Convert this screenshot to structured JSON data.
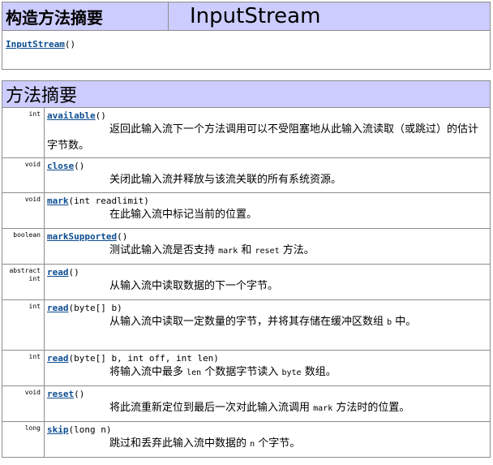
{
  "constructor_summary": {
    "heading": "构造方法摘要",
    "class_name": "InputStream",
    "constructor": {
      "name": "InputStream",
      "params": "()"
    }
  },
  "method_summary": {
    "heading": "方法摘要",
    "methods": [
      {
        "type": "int",
        "name": "available",
        "params": "()",
        "desc": "返回此输入流下一个方法调用可以不受阻塞地从此输入流读取（或跳过）的估计字节数。"
      },
      {
        "type": "void",
        "name": "close",
        "params": "()",
        "desc": "关闭此输入流并释放与该流关联的所有系统资源。"
      },
      {
        "type": "void",
        "name": "mark",
        "params": "(int readlimit)",
        "desc": "在此输入流中标记当前的位置。"
      },
      {
        "type": "boolean",
        "name": "markSupported",
        "params": "()",
        "desc_pre": "测试此输入流是否支持 ",
        "desc_code1": "mark",
        "desc_mid": " 和 ",
        "desc_code2": "reset",
        "desc_post": " 方法。"
      },
      {
        "type": "abstract int",
        "type_line1": "abstract",
        "type_line2": "int",
        "name": "read",
        "params": "()",
        "desc": "从输入流中读取数据的下一个字节。"
      },
      {
        "type": "int",
        "name": "read",
        "params": "(byte[] b)",
        "desc_pre": "从输入流中读取一定数量的字节，并将其存储在缓冲区数组 ",
        "desc_code1": "b",
        "desc_post": " 中。"
      },
      {
        "type": "int",
        "name": "read",
        "params": "(byte[] b, int off, int len)",
        "desc_pre": "将输入流中最多 ",
        "desc_code1": "len",
        "desc_mid": " 个数据字节读入 ",
        "desc_code2": "byte",
        "desc_post": " 数组。"
      },
      {
        "type": "void",
        "name": "reset",
        "params": "()",
        "desc_pre": "将此流重新定位到最后一次对此输入流调用 ",
        "desc_code1": "mark",
        "desc_post": " 方法时的位置。"
      },
      {
        "type": "long",
        "name": "skip",
        "params": "(long n)",
        "desc_pre": "跳过和丢弃此输入流中数据的 ",
        "desc_code1": "n",
        "desc_post": " 个字节。"
      }
    ]
  }
}
